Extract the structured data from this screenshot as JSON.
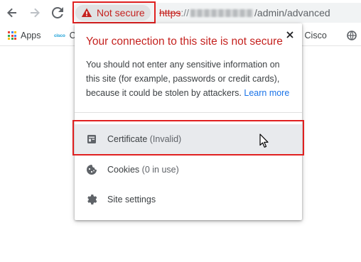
{
  "toolbar": {
    "security_chip_label": "Not secure",
    "url_scheme": "https",
    "url_sep": "://",
    "url_path": "/admin/advanced"
  },
  "bookmarks": {
    "apps_label": "Apps",
    "cisco_label": "C",
    "cisco_logo_text": "cisco",
    "right_label": "et - Cisco"
  },
  "popup": {
    "title": "Your connection to this site is not secure",
    "body_text": "You should not enter any sensitive information on this site (for example, passwords or credit cards), because it could be stolen by attackers.",
    "learn_more": "Learn more",
    "certificate_label": "Certificate",
    "certificate_status": "(Invalid)",
    "cookies_label": "Cookies",
    "cookies_status": "(0 in use)",
    "site_settings_label": "Site settings"
  },
  "colors": {
    "warning_red": "#c5221f",
    "link_blue": "#1a73e8",
    "annotation_red": "#e02020",
    "hover_row": "#e8eaed"
  },
  "icons": {
    "back": "arrow-left-icon",
    "forward": "arrow-right-icon",
    "reload": "reload-icon",
    "warning": "warning-triangle-icon",
    "apps": "apps-grid-icon",
    "globe": "globe-icon",
    "close": "close-icon",
    "certificate": "certificate-icon",
    "cookies": "cookie-icon",
    "settings": "gear-icon",
    "cursor": "mouse-pointer-icon"
  }
}
